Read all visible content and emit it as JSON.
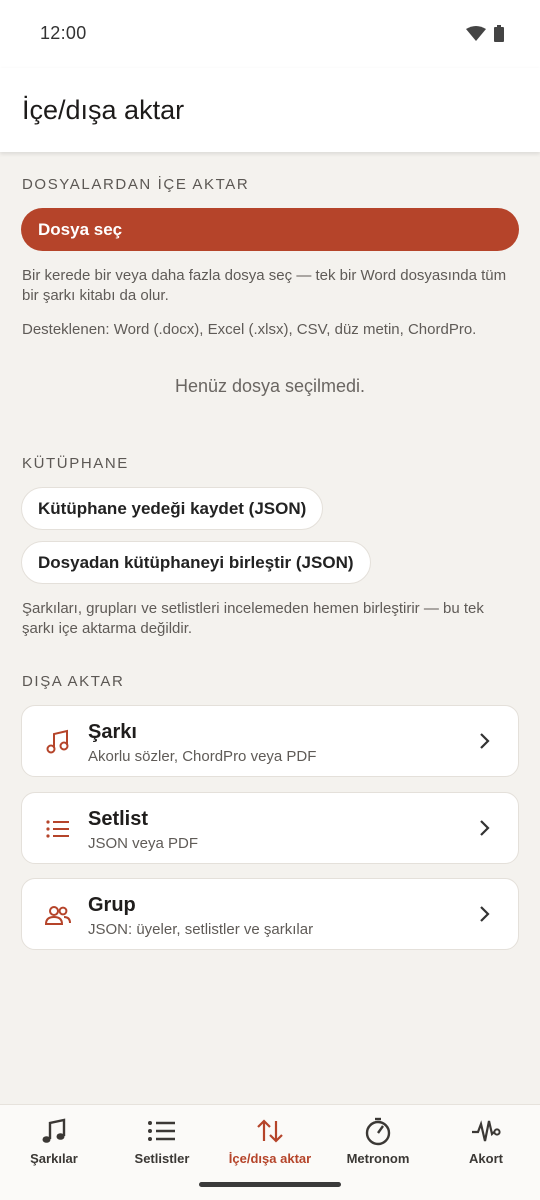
{
  "status_bar": {
    "time": "12:00"
  },
  "app_bar": {
    "title": "İçe/dışa aktar"
  },
  "import_section": {
    "header": "DOSYALARDAN İÇE AKTAR",
    "choose_button": "Dosya seç",
    "help_line_1": "Bir kerede bir veya daha fazla dosya seç — tek bir Word dosyasında tüm bir şarkı kitabı da olur.",
    "help_line_2": "Desteklenen: Word (.docx), Excel (.xlsx), CSV, düz metin, ChordPro.",
    "empty_state": "Henüz dosya seçilmedi."
  },
  "library_section": {
    "header": "KÜTÜPHANE",
    "backup_button": "Kütüphane yedeği kaydet (JSON)",
    "merge_button": "Dosyadan kütüphaneyi birleştir (JSON)",
    "help": "Şarkıları, grupları ve setlistleri incelemeden hemen birleştirir — bu tek şarkı içe aktarma değildir."
  },
  "export_section": {
    "header": "DIŞA AKTAR",
    "items": [
      {
        "title": "Şarkı",
        "subtitle": "Akorlu sözler, ChordPro veya PDF",
        "icon": "music-note-icon"
      },
      {
        "title": "Setlist",
        "subtitle": "JSON veya PDF",
        "icon": "list-icon"
      },
      {
        "title": "Grup",
        "subtitle": "JSON: üyeler, setlistler ve şarkılar",
        "icon": "people-icon"
      }
    ]
  },
  "bottom_nav": {
    "items": [
      {
        "label": "Şarkılar",
        "icon": "music-note-icon",
        "active": false
      },
      {
        "label": "Setlistler",
        "icon": "list-icon",
        "active": false
      },
      {
        "label": "İçe/dışa aktar",
        "icon": "import-export-icon",
        "active": true
      },
      {
        "label": "Metronom",
        "icon": "metronome-icon",
        "active": false
      },
      {
        "label": "Akort",
        "icon": "tuner-icon",
        "active": false
      }
    ]
  },
  "colors": {
    "accent": "#b5442a",
    "background": "#f4f2ee",
    "surface": "#ffffff"
  }
}
